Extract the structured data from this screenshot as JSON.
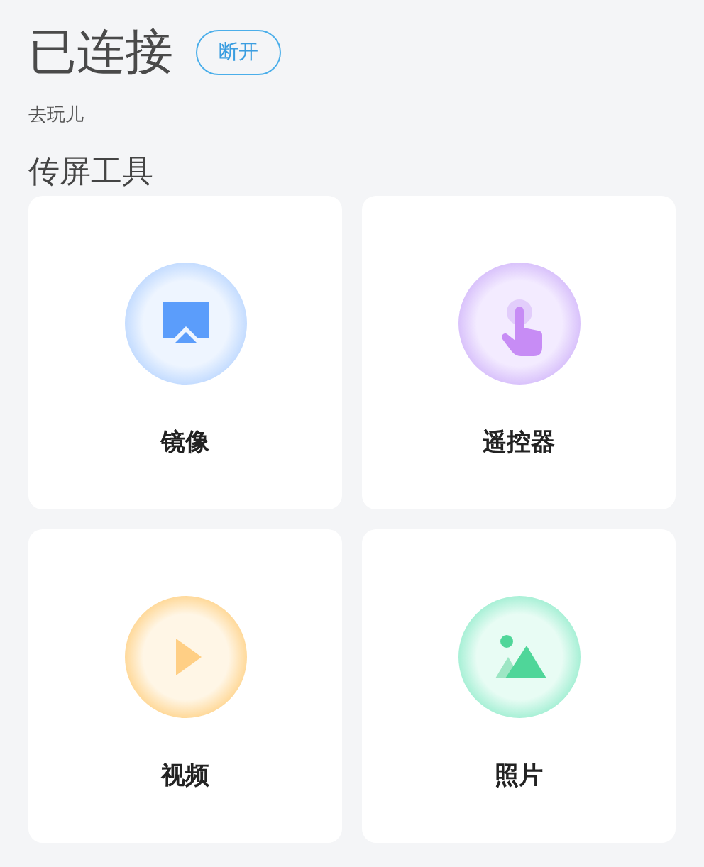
{
  "header": {
    "status": "已连接",
    "button": "断开",
    "subtitle": "去玩儿"
  },
  "section": {
    "title": "传屏工具",
    "tools": [
      {
        "kind": "mirror",
        "label": "镜像"
      },
      {
        "kind": "remote",
        "label": "遥控器"
      },
      {
        "kind": "video",
        "label": "视频"
      },
      {
        "kind": "photo",
        "label": "照片"
      }
    ]
  }
}
